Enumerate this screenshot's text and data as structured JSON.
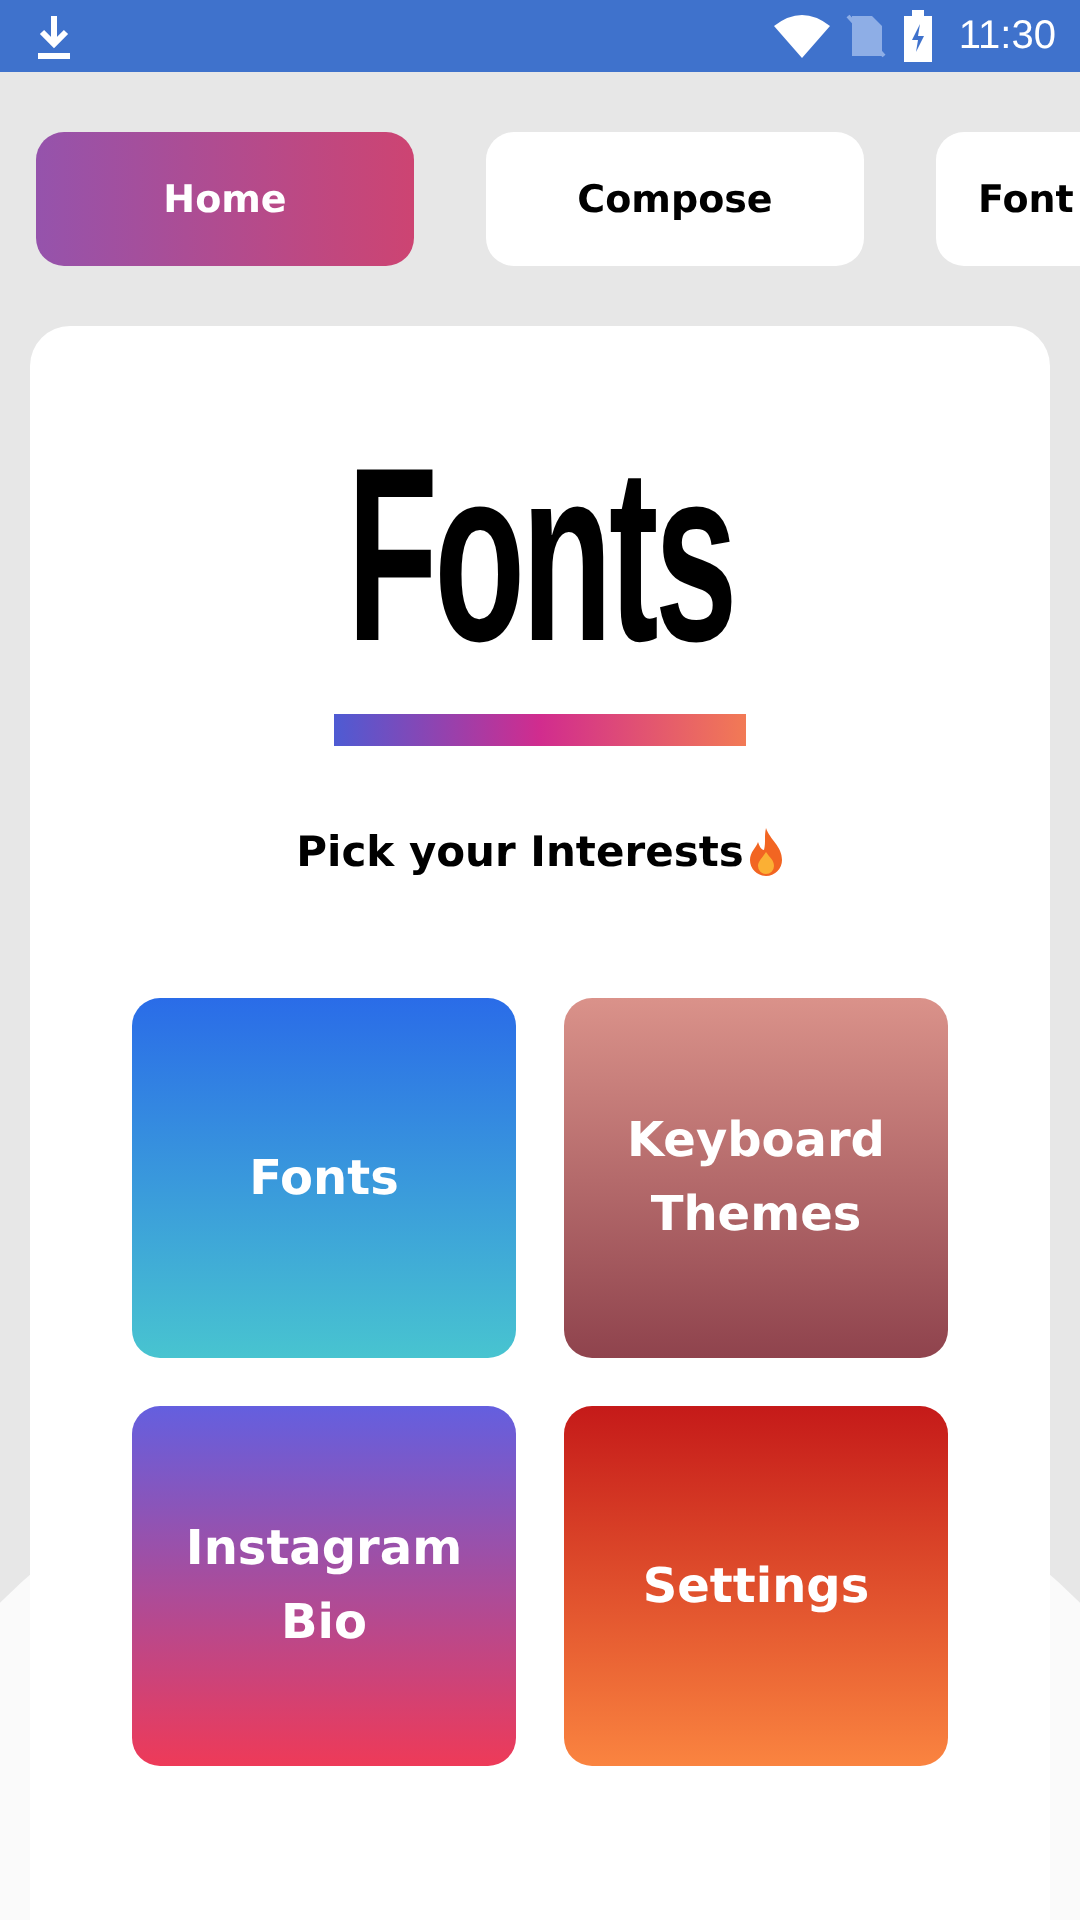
{
  "status_bar": {
    "time": "11:30"
  },
  "tabs": [
    {
      "label": "Home",
      "selected": true
    },
    {
      "label": "Compose",
      "selected": false
    },
    {
      "label": "Font",
      "selected": false
    }
  ],
  "logo": {
    "text": "Fonts"
  },
  "heading": "Pick your Interests",
  "tiles": [
    {
      "label": "Fonts"
    },
    {
      "label": "Keyboard Themes"
    },
    {
      "label": "Instagram Bio"
    },
    {
      "label": "Settings"
    }
  ]
}
